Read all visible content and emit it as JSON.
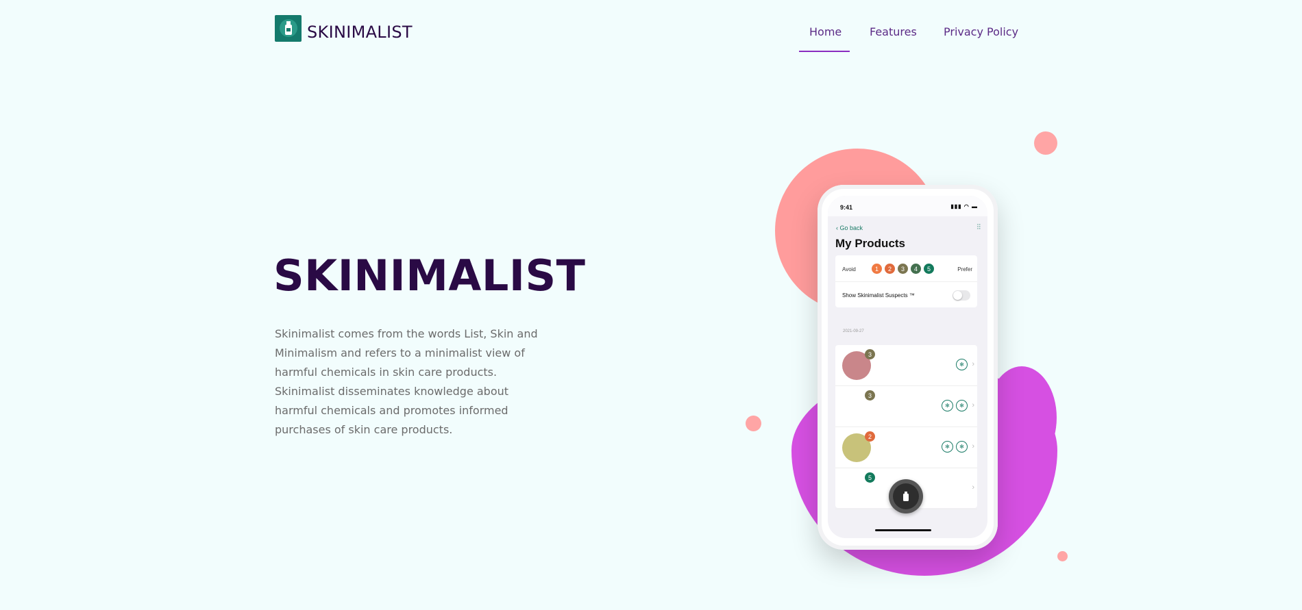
{
  "brand": {
    "name": "SKINIMALIST",
    "logo_icon": "bottle-icon",
    "accent": "#147a6c"
  },
  "nav": {
    "items": [
      "Home",
      "Features",
      "Privacy Policy"
    ],
    "active": "Home"
  },
  "hero": {
    "title": "SKINIMALIST",
    "description": "Skinimalist comes from the words List, Skin and Minimalism and refers to a minimalist view of harmful chemicals in skin care products. Skinimalist disseminates knowledge about harmful chemicals and promotes informed purchases of skin care products."
  },
  "phone": {
    "time": "9:41",
    "status_icons": "signal-wifi-battery",
    "back_label": "Go back",
    "title": "My Products",
    "avoid_label": "Avoid",
    "prefer_label": "Prefer",
    "scale": [
      {
        "n": "1",
        "color": "#f07a43"
      },
      {
        "n": "2",
        "color": "#e06a3c"
      },
      {
        "n": "3",
        "color": "#7b7550"
      },
      {
        "n": "4",
        "color": "#44704f"
      },
      {
        "n": "5",
        "color": "#137a5c"
      }
    ],
    "suspects_label": "Show Skinimalist Suspects ™",
    "date": "2021-09-27",
    "products": [
      {
        "score": "3",
        "badge_color": "#7b7550",
        "thumb": "#c9868a",
        "rings": 1
      },
      {
        "score": "3",
        "badge_color": "#7b7550",
        "thumb": "#ffffff",
        "rings": 2
      },
      {
        "score": "2",
        "badge_color": "#e06a3c",
        "thumb": "#c8c27a",
        "rings": 2
      },
      {
        "score": "5",
        "badge_color": "#137a5c",
        "thumb": "#ffffff",
        "rings": 0
      }
    ]
  }
}
